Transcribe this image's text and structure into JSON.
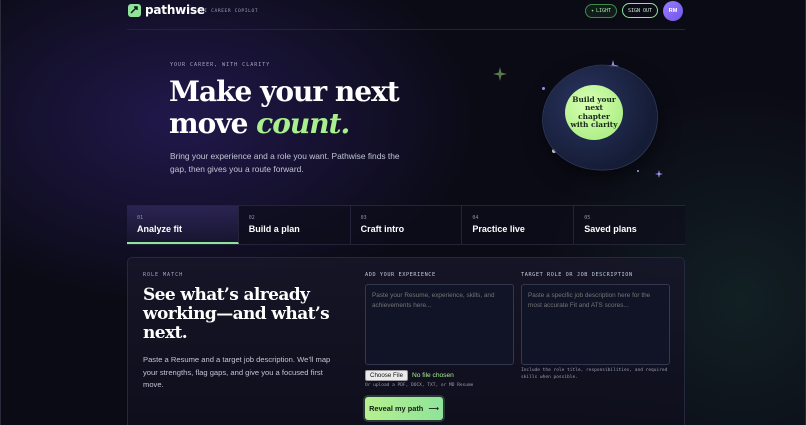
{
  "brand": {
    "name": "pathwise",
    "tagline": "AI CAREER COPILOT",
    "accent_color": "#8fe39a"
  },
  "header": {
    "light_toggle_label": "LIGHT",
    "sign_out_label": "SIGN OUT",
    "avatar_initials": "RM"
  },
  "hero": {
    "eyebrow": "YOUR CAREER, WITH CLARITY",
    "title_line1": "Make your next",
    "title_line2_plain": "move",
    "title_line2_accent": "count.",
    "subtitle": "Bring your experience and a role you want. Pathwise finds the gap, then gives you a route forward.",
    "badge_text": "Build your next chapter with clarity"
  },
  "tabs": [
    {
      "num": "01",
      "label": "Analyze fit",
      "active": true
    },
    {
      "num": "02",
      "label": "Build a plan",
      "active": false
    },
    {
      "num": "03",
      "label": "Craft intro",
      "active": false
    },
    {
      "num": "04",
      "label": "Practice live",
      "active": false
    },
    {
      "num": "05",
      "label": "Saved plans",
      "active": false
    }
  ],
  "role_match": {
    "eyebrow": "ROLE MATCH",
    "title": "See what’s already working—and what’s next.",
    "subtitle": "Paste a Resume and a target job description. We’ll map your strengths, flag gaps, and give you a focused first move.",
    "experience_label": "ADD YOUR EXPERIENCE",
    "experience_placeholder": "Paste your Resume, experience, skills, and achievements here...",
    "target_label": "TARGET ROLE OR JOB DESCRIPTION",
    "target_placeholder": "Paste a specific job description here for the most accurate Fit and ATS scores...",
    "file_button_label": "Choose File",
    "file_status": "No file chosen",
    "upload_hint": "Or upload a PDF, DOCX, TXT, or MD Resume",
    "target_hint": "Include the role title, responsibilities, and required skills when possible.",
    "cta_label": "Reveal my path"
  }
}
